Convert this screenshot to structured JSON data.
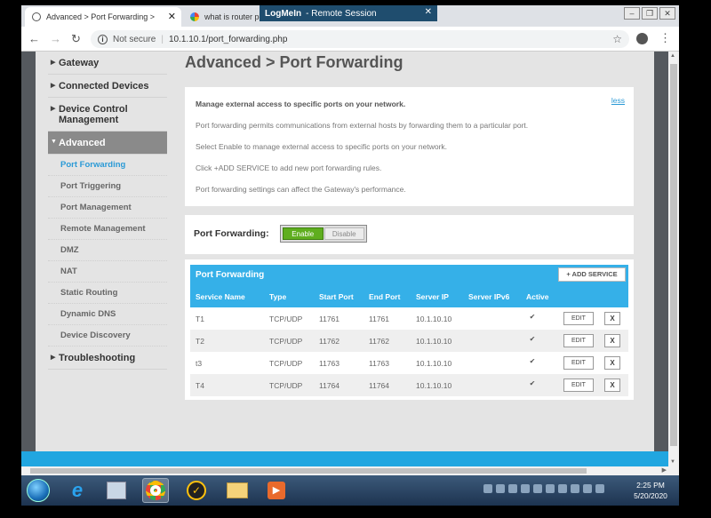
{
  "browser": {
    "active_tab_title": "Advanced > Port Forwarding > ",
    "inactive_tab_title": "what is router po",
    "not_secure": "Not secure",
    "url": "10.1.10.1/port_forwarding.php"
  },
  "logmein": {
    "brand": "LogMeIn",
    "label": "Remote Session"
  },
  "nav": {
    "items": [
      {
        "label": "Gateway"
      },
      {
        "label": "Connected Devices"
      },
      {
        "label": "Device Control Management"
      },
      {
        "label": "Advanced"
      },
      {
        "label": "Troubleshooting"
      }
    ],
    "sub_items": [
      {
        "label": "Port Forwarding"
      },
      {
        "label": "Port Triggering"
      },
      {
        "label": "Port Management"
      },
      {
        "label": "Remote Management"
      },
      {
        "label": "DMZ"
      },
      {
        "label": "NAT"
      },
      {
        "label": "Static Routing"
      },
      {
        "label": "Dynamic DNS"
      },
      {
        "label": "Device Discovery"
      }
    ]
  },
  "page": {
    "title": "Advanced > Port Forwarding",
    "less_link": "less",
    "info": [
      "Manage external access to specific ports on your network.",
      "Port forwarding permits communications from external hosts by forwarding them to a particular port.",
      "Select Enable to manage external access to specific ports on your network.",
      "Click +ADD SERVICE to add new port forwarding rules.",
      "Port forwarding settings can affect the Gateway's performance."
    ],
    "toggle_label": "Port Forwarding:",
    "enable_label": "Enable",
    "disable_label": "Disable"
  },
  "table": {
    "caption": "Port Forwarding",
    "add_label": "+ ADD SERVICE",
    "columns": [
      "Service Name",
      "Type",
      "Start Port",
      "End Port",
      "Server IP",
      "Server IPv6",
      "Active"
    ],
    "edit_label": "EDIT",
    "delete_label": "X",
    "rows": [
      {
        "name": "T1",
        "type": "TCP/UDP",
        "start": "11761",
        "end": "11761",
        "ip": "10.1.10.10",
        "ipv6": "",
        "active": "✔"
      },
      {
        "name": "T2",
        "type": "TCP/UDP",
        "start": "11762",
        "end": "11762",
        "ip": "10.1.10.10",
        "ipv6": "",
        "active": "✔"
      },
      {
        "name": "t3",
        "type": "TCP/UDP",
        "start": "11763",
        "end": "11763",
        "ip": "10.1.10.10",
        "ipv6": "",
        "active": "✔"
      },
      {
        "name": "T4",
        "type": "TCP/UDP",
        "start": "11764",
        "end": "11764",
        "ip": "10.1.10.10",
        "ipv6": "",
        "active": "✔"
      }
    ]
  },
  "taskbar": {
    "time": "2:25 PM",
    "date": "5/20/2020"
  },
  "colors": {
    "accent": "#35b0e8",
    "enable_green": "#5fae1f",
    "nav_active": "#8a8a8a"
  }
}
